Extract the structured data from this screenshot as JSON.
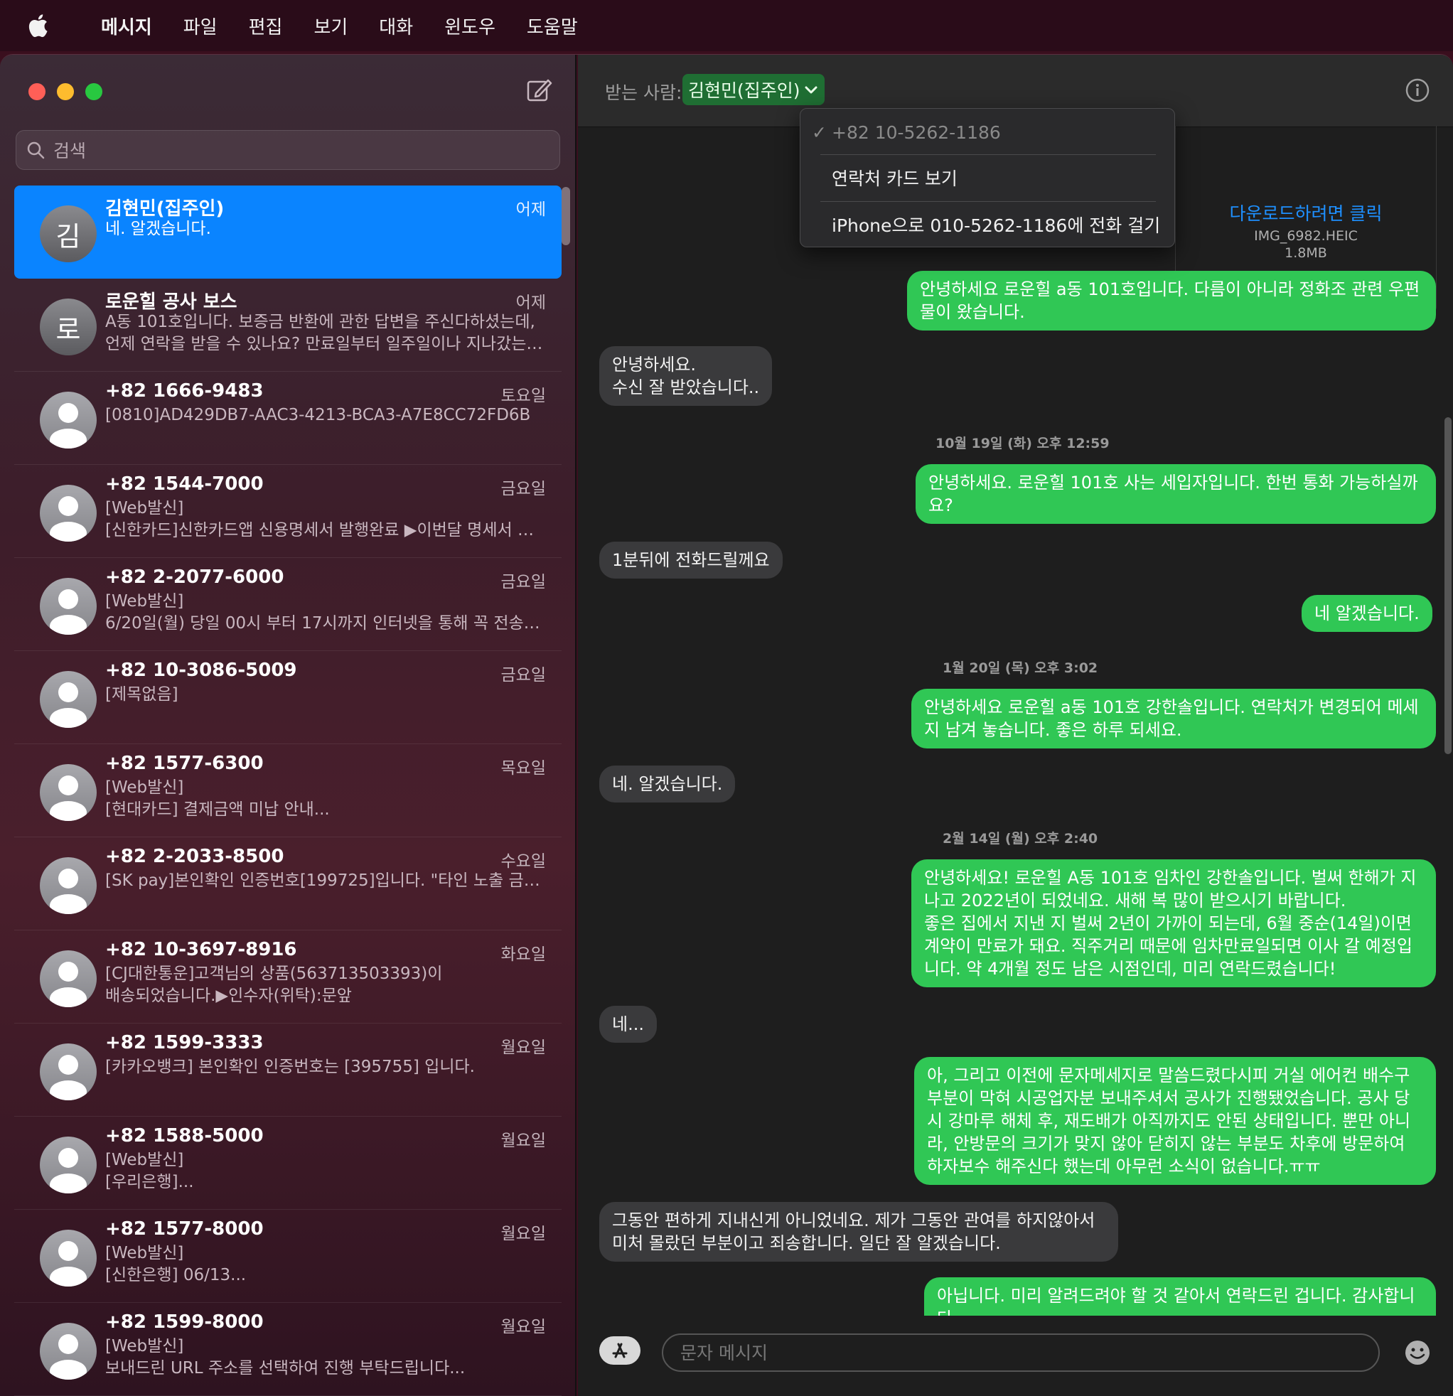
{
  "menubar": {
    "items": [
      "메시지",
      "파일",
      "편집",
      "보기",
      "대화",
      "윈도우",
      "도움말"
    ]
  },
  "sidebar": {
    "search_placeholder": "검색",
    "conversations": [
      {
        "name": "김현민(집주인)",
        "date": "어제",
        "avatar": "김",
        "preview": [
          "네. 알겠습니다."
        ]
      },
      {
        "name": "로운힐 공사 보스",
        "date": "어제",
        "avatar": "로",
        "preview": [
          "A동 101호입니다. 보증금 반환에 관한 답변을 주신다하셨는데,",
          "언제 연락을 받을 수 있나요? 만료일부터 일주일이나 지나갔는데..."
        ]
      },
      {
        "name": "+82 1666-9483",
        "date": "토요일",
        "avatar": "",
        "preview": [
          "[0810]AD429DB7-AAC3-4213-BCA3-A7E8CC72FD6B"
        ]
      },
      {
        "name": "+82 1544-7000",
        "date": "금요일",
        "avatar": "",
        "preview": [
          "[Web발신]",
          "[신한카드]신한카드앱 신용명세서 발행완료 ▶이번달 명세서 바로…"
        ]
      },
      {
        "name": "+82 2-2077-6000",
        "date": "금요일",
        "avatar": "",
        "preview": [
          "[Web발신]",
          "6/20일(월) 당일 00시 부터 17시까지 인터넷을 통해 꼭 전송하세…"
        ]
      },
      {
        "name": "+82 10-3086-5009",
        "date": "금요일",
        "avatar": "",
        "preview": [
          "[제목없음]"
        ]
      },
      {
        "name": "+82 1577-6300",
        "date": "목요일",
        "avatar": "",
        "preview": [
          "[Web발신]",
          "[현대카드] 결제금액 미납 안내..."
        ]
      },
      {
        "name": "+82 2-2033-8500",
        "date": "수요일",
        "avatar": "",
        "preview": [
          "[SK pay]본인확인 인증번호[199725]입니다. \"타인 노출 금지\""
        ]
      },
      {
        "name": "+82 10-3697-8916",
        "date": "화요일",
        "avatar": "",
        "preview": [
          "[CJ대한통운]고객님의 상품(563713503393)이",
          "배송되었습니다.▶인수자(위탁):문앞"
        ]
      },
      {
        "name": "+82 1599-3333",
        "date": "월요일",
        "avatar": "",
        "preview": [
          "[카카오뱅크] 본인확인 인증번호는 [395755] 입니다."
        ]
      },
      {
        "name": "+82 1588-5000",
        "date": "월요일",
        "avatar": "",
        "preview": [
          "[Web발신]",
          "[우리은행]..."
        ]
      },
      {
        "name": "+82 1577-8000",
        "date": "월요일",
        "avatar": "",
        "preview": [
          "[Web발신]",
          "[신한은행] 06/13..."
        ]
      },
      {
        "name": "+82 1599-8000",
        "date": "월요일",
        "avatar": "",
        "preview": [
          "[Web발신]",
          "보내드린 URL 주소를 선택하여 진행 부탁드립니다..."
        ]
      }
    ]
  },
  "header": {
    "to_label": "받는 사람:",
    "recipient": "김현민(집주인)"
  },
  "dropdown": {
    "phone": "+82 10-5262-1186",
    "view_card": "연락처 카드 보기",
    "call": "iPhone으로 010-5262-1186에 전화 걸기"
  },
  "attachment": {
    "link": "다운로드하려면 클릭",
    "filename": "IMG_6982.HEIC",
    "size": "1.8MB"
  },
  "messages": {
    "m1": "안녕하세요 로운힐 a동 101호입니다. 다름이 아니라 정화조 관련 우편\n물이 왔습니다.",
    "m2": "안녕하세요.\n수신 잘 받았습니다..",
    "t1": "10월 19일 (화) 오후 12:59",
    "m3": "안녕하세요. 로운힐 101호 사는 세입자입니다. 한번 통화 가능하실까\n요?",
    "m4": "1분뒤에 전화드릴께요",
    "m5": "네 알겠습니다.",
    "t2": "1월 20일 (목) 오후 3:02",
    "m6": "안녕하세요 로운힐 a동 101호 강한솔입니다. 연락처가 변경되어 메세\n지 남겨 놓습니다. 좋은 하루 되세요.",
    "m7": "네. 알겠습니다.",
    "t3": "2월 14일 (월) 오후 2:40",
    "m8": "안녕하세요! 로운힐 A동 101호 임차인 강한솔입니다. 벌써 한해가 지\n나고 2022년이 되었네요. 새해 복 많이 받으시기 바랍니다.\n좋은 집에서 지낸 지 벌써 2년이 가까이 되는데, 6월 중순(14일)이면\n계약이 만료가 돼요. 직주거리 때문에 임차만료일되면 이사 갈 예정입\n니다. 약 4개월 정도 남은 시점인데, 미리 연락드렸습니다!",
    "m9": "네...",
    "m10": "아, 그리고 이전에 문자메세지로 말씀드렸다시피 거실 에어컨 배수구\n부분이 막혀 시공업자분 보내주셔서 공사가 진행됐었습니다. 공사 당\n시 강마루 해체 후, 재도배가 아직까지도 안된 상태입니다. 뿐만 아니\n라, 안방문의 크기가 맞지 않아 닫히지 않는 부분도 차후에 방문하여\n하자보수 해주신다 했는데 아무런 소식이 없습니다.ㅠㅠ",
    "m11": "그동안 편하게 지내신게 아니었네요. 제가 그동안 관여를 하지않아서\n미처 몰랐던 부분이고 죄송합니다. 일단 잘 알겠습니다.",
    "m12": "아닙니다. 미리 알려드려야 할 것 같아서 연락드린 겁니다. 감사합니\n다."
  },
  "composer": {
    "placeholder": "문자 메시지"
  },
  "colors": {
    "selected": "#0a84ff",
    "outgoing": "#30c755",
    "incoming": "#3a3a3c",
    "link": "#1e90ff"
  }
}
